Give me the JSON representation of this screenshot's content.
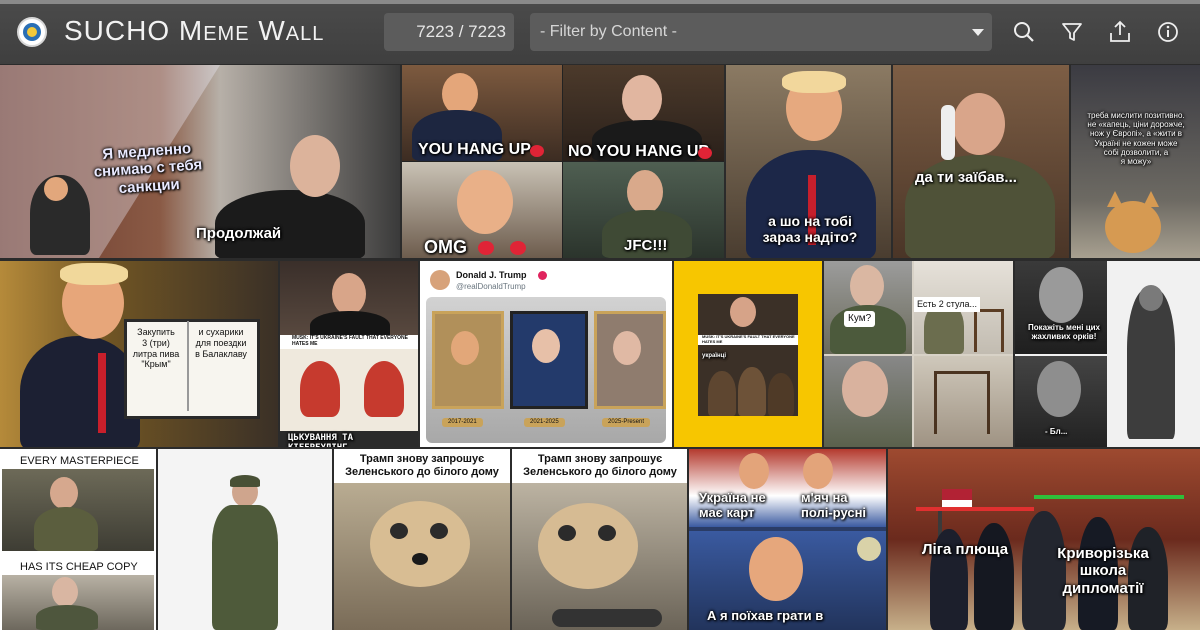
{
  "app": {
    "title": "SUCHO Meme Wall",
    "counter": "7223 / 7223",
    "filter_placeholder": "- Filter by Content -"
  },
  "header_icons": [
    "search-icon",
    "filter-icon",
    "upload-icon",
    "info-icon"
  ],
  "colors": {
    "header": "#444444",
    "input_bg": "#5c5c5c",
    "yellow_frame": "#f7c600"
  },
  "memes": {
    "sanctions": {
      "top": "Я медленно\nснимаю с тебя\nсанкции",
      "bottom": "Продолжай"
    },
    "hang_up": {
      "a": "YOU HANG UP",
      "b": "NO YOU HANG UP",
      "c": "OMG",
      "d": "JFC!!!"
    },
    "wearing": {
      "text": "а шо на тобі\nзараз надіто?"
    },
    "zelensky_phone": {
      "text": "да ти заїбав..."
    },
    "cat": {
      "text": "треба мислити позитивно.\nне «капець, ціни дорожче,\nнож у Європі», а «жити в\nУкраїні не кожен може\nсобі дозволити, а\nя можу»"
    },
    "crimea": {
      "left": "Закупить\n3 (три)\nлитра пива\n\"Крым\"",
      "right": "и сухарики\nдля поездки\nв Балаклаву"
    },
    "musk_fault": {
      "banner": "MUSK: IT'S UKRAINE'S FAULT THAT EVERYONE HATES ME",
      "bottom": "ЦЬКУВАННЯ ТА КІБЕРБУЛІНГ"
    },
    "tweet": {
      "name": "Donald J. Trump",
      "handle": "@realDonaldTrump",
      "plaques": [
        "2017-2021",
        "2021-2025",
        "2025-Present"
      ]
    },
    "musk_yellow": {
      "banner": "MUSK: IT'S UKRAINE'S FAULT THAT EVERYONE HATES ME",
      "sub": "українці"
    },
    "chairs": {
      "q": "Кум?",
      "a": "Есть 2 стула..."
    },
    "orcs": {
      "top": "Покажіть мені цих\nжахливих орків!",
      "bottom": "- Бл..."
    },
    "masterpiece": {
      "top": "EVERY MASTERPIECE",
      "bottom": "HAS ITS CHEAP COPY"
    },
    "invite_a": {
      "text": "Трамп знову запрошує\nЗеленського до білого дому"
    },
    "invite_b": {
      "text": "Трамп знову запрошує\nЗеленського до білого дому"
    },
    "cards": {
      "left": "Україна не\nмає карт",
      "right": "м'яч на\nполі-русні",
      "bottom": "А я поїхав грати в"
    },
    "diplomacy": {
      "left": "Ліга плюща",
      "right": "Криворізька\nшкола\nдипломатії"
    }
  }
}
